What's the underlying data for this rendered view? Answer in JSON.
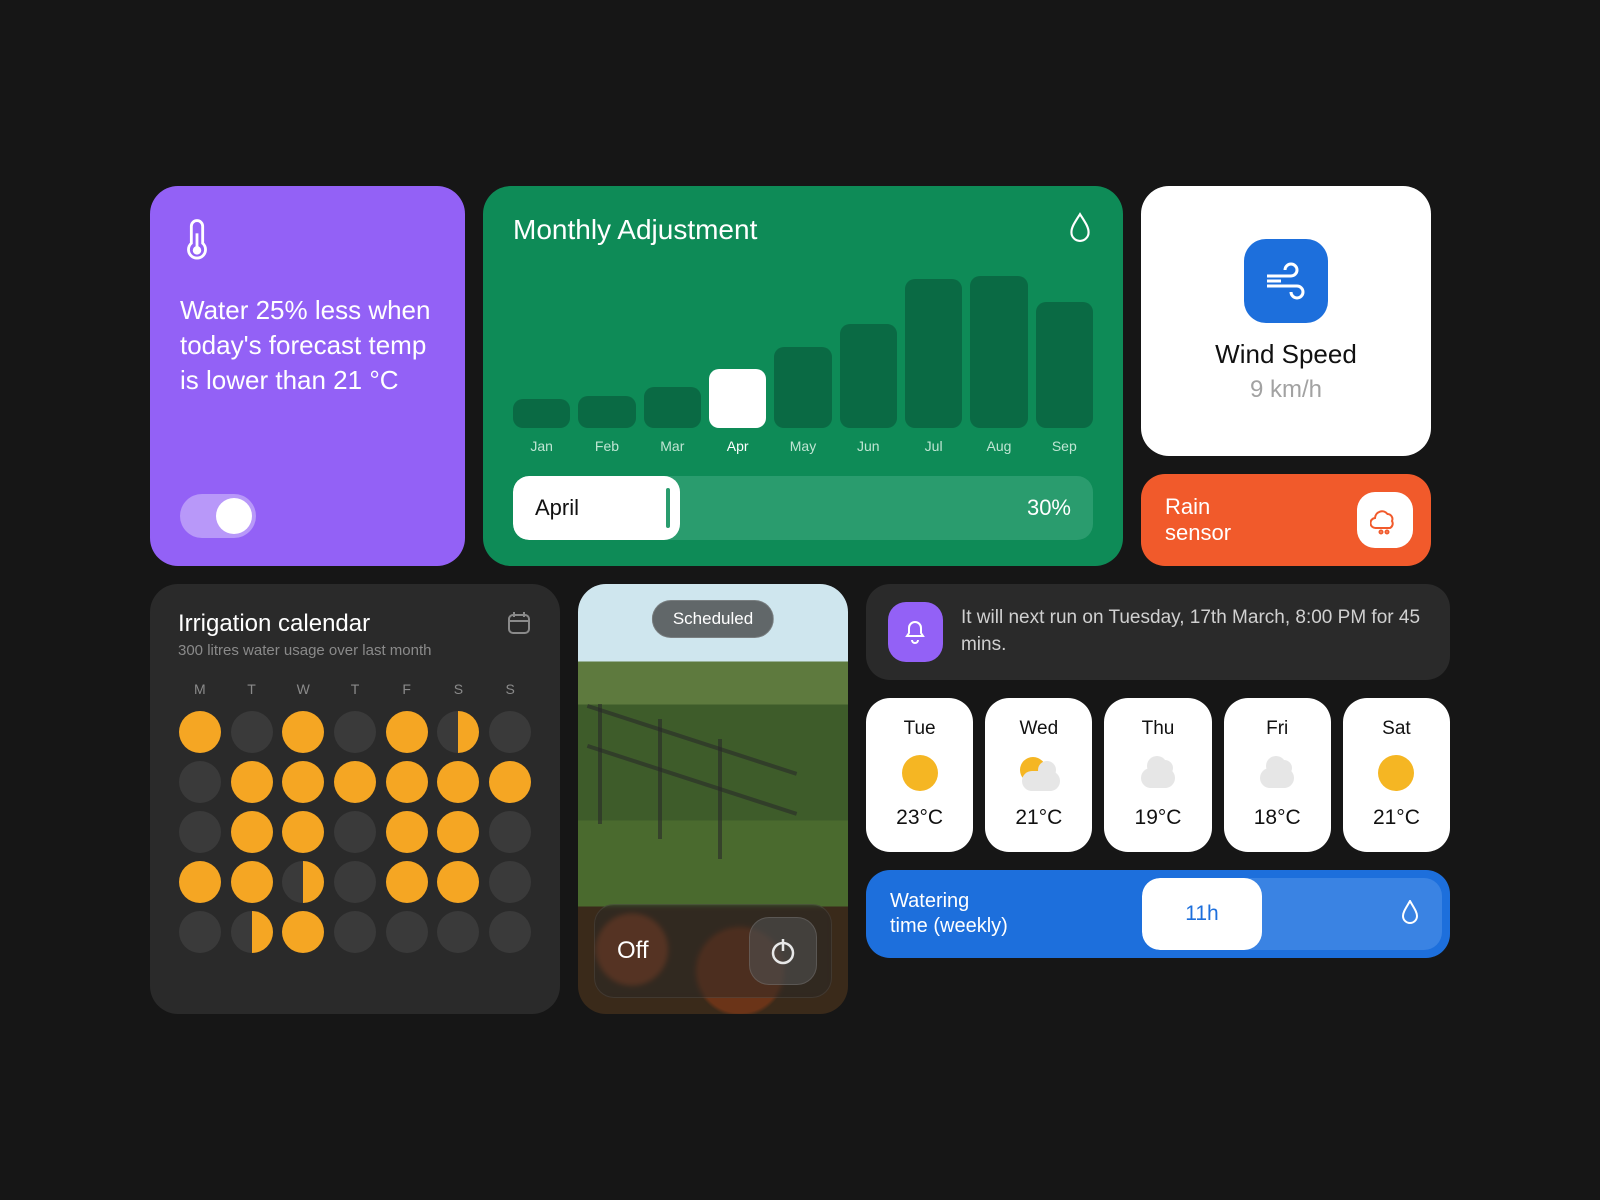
{
  "rule": {
    "text": "Water 25% less when today's forecast temp is lower than 21 °C",
    "toggle_on": true
  },
  "monthly": {
    "title": "Monthly Adjustment",
    "selected_month": "April",
    "selected_value": "30%"
  },
  "chart_data": {
    "type": "bar",
    "categories": [
      "Jan",
      "Feb",
      "Mar",
      "Apr",
      "May",
      "Jun",
      "Jul",
      "Aug",
      "Sep"
    ],
    "values": [
      10,
      12,
      18,
      30,
      45,
      60,
      90,
      92,
      75
    ],
    "title": "Monthly Adjustment",
    "xlabel": "",
    "ylabel": "%",
    "ylim": [
      0,
      100
    ],
    "highlighted_category": "Apr"
  },
  "wind": {
    "title": "Wind Speed",
    "value": "9 km/h"
  },
  "rain_sensor": {
    "label": "Rain sensor"
  },
  "calendar": {
    "title": "Irrigation calendar",
    "subtitle": "300 litres water usage over last month",
    "days_of_week": [
      "M",
      "T",
      "W",
      "T",
      "F",
      "S",
      "S"
    ],
    "cells": [
      "full",
      "empty",
      "full",
      "empty",
      "full",
      "half",
      "empty",
      "empty",
      "full",
      "full",
      "full",
      "full",
      "full",
      "full",
      "empty",
      "full",
      "full",
      "empty",
      "full",
      "full",
      "empty",
      "full",
      "full",
      "half",
      "empty",
      "full",
      "full",
      "empty",
      "empty",
      "half",
      "full",
      "empty",
      "empty",
      "empty",
      "empty"
    ]
  },
  "garden": {
    "status_tag": "Scheduled",
    "power_label": "Off"
  },
  "next_run": {
    "text": "It will next run on Tuesday, 17th March, 8:00 PM for 45 mins."
  },
  "forecast": [
    {
      "dow": "Tue",
      "icon": "sun",
      "temp": "23°C"
    },
    {
      "dow": "Wed",
      "icon": "partly",
      "temp": "21°C"
    },
    {
      "dow": "Thu",
      "icon": "cloud",
      "temp": "19°C"
    },
    {
      "dow": "Fri",
      "icon": "cloud",
      "temp": "18°C"
    },
    {
      "dow": "Sat",
      "icon": "sun",
      "temp": "21°C"
    }
  ],
  "watering": {
    "label": "Watering time (weekly)",
    "value": "11h"
  }
}
